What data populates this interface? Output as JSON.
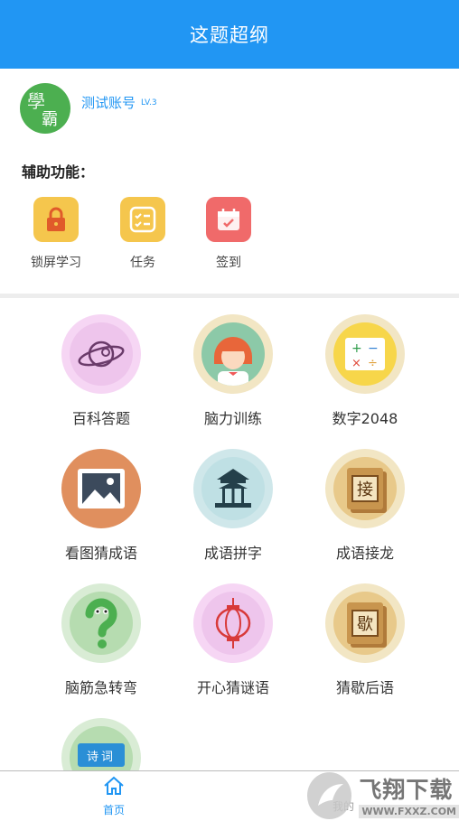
{
  "header": {
    "title": "这题超纲"
  },
  "profile": {
    "avatar_text_1": "學",
    "avatar_text_2": "霸",
    "name": "测试账号",
    "level": "LV.3"
  },
  "aux": {
    "title": "辅助功能：",
    "items": [
      {
        "label": "锁屏学习",
        "icon": "lock-icon",
        "color": "#f5c64d"
      },
      {
        "label": "任务",
        "icon": "task-list-icon",
        "color": "#f5c64d"
      },
      {
        "label": "签到",
        "icon": "calendar-icon",
        "color": "#f06a6a"
      }
    ]
  },
  "games": [
    {
      "label": "百科答题",
      "icon": "planet-icon"
    },
    {
      "label": "脑力训练",
      "icon": "girl-avatar-icon"
    },
    {
      "label": "数字2048",
      "icon": "math-operators-icon"
    },
    {
      "label": "看图猜成语",
      "icon": "picture-icon"
    },
    {
      "label": "成语拼字",
      "icon": "pavilion-icon"
    },
    {
      "label": "成语接龙",
      "icon": "book-jie-icon",
      "book_char": "接"
    },
    {
      "label": "脑筋急转弯",
      "icon": "question-mark-icon"
    },
    {
      "label": "开心猜谜语",
      "icon": "lantern-icon"
    },
    {
      "label": "猜歇后语",
      "icon": "book-xie-icon",
      "book_char": "歇"
    },
    {
      "label": "",
      "icon": "poem-book-icon",
      "book_char": "诗词"
    }
  ],
  "tabbar": {
    "home_label": "首页",
    "second_label": "我的"
  },
  "watermark": {
    "brand": "飞翔下载",
    "url": "WWW.FXXZ.COM"
  }
}
